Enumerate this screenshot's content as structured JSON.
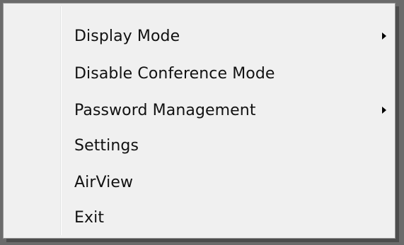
{
  "context_menu": {
    "items": [
      {
        "label": "Display Mode",
        "has_submenu": true,
        "icon": "submenu-arrow-icon"
      },
      {
        "label": "Disable Conference Mode",
        "has_submenu": false
      },
      {
        "label": "Password Management",
        "has_submenu": true,
        "icon": "submenu-arrow-icon"
      },
      {
        "label": "Settings",
        "has_submenu": false
      },
      {
        "label": "AirView",
        "has_submenu": false
      },
      {
        "label": "Exit",
        "has_submenu": false
      }
    ]
  },
  "colors": {
    "menu_background": "#f0f0f0",
    "menu_border": "#979797",
    "desktop_background": "#6b6b6b",
    "text": "#111111"
  }
}
